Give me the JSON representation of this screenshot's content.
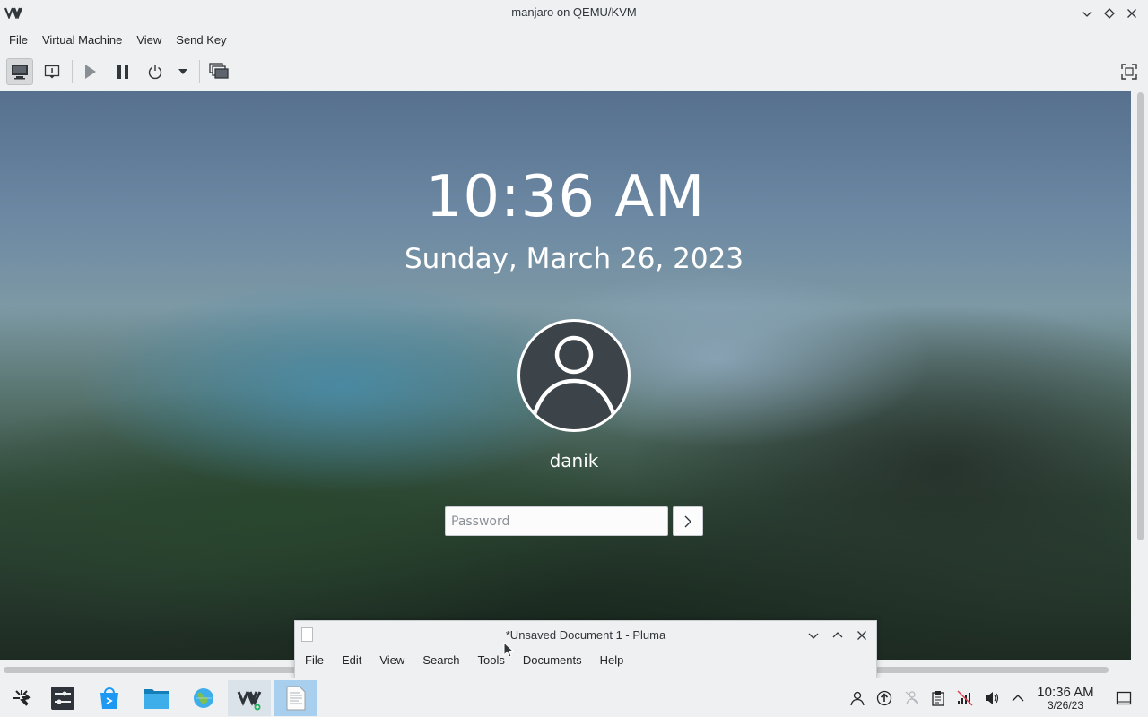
{
  "window": {
    "title": "manjaro on QEMU/KVM",
    "logo": "VM"
  },
  "menubar": {
    "items": [
      "File",
      "Virtual Machine",
      "View",
      "Send Key"
    ]
  },
  "toolbar": {
    "buttons": [
      "console-icon",
      "details-icon",
      "run-icon",
      "pause-icon",
      "shutdown-icon",
      "shutdown-menu-icon",
      "snapshots-icon",
      "fullscreen-icon"
    ]
  },
  "lockscreen": {
    "time": "10:36 AM",
    "date": "Sunday, March 26, 2023",
    "username": "danik",
    "password_placeholder": "Password",
    "password_value": ""
  },
  "pluma": {
    "title": "*Unsaved Document 1 - Pluma",
    "menu": [
      "File",
      "Edit",
      "View",
      "Search",
      "Tools",
      "Documents",
      "Help"
    ]
  },
  "taskbar": {
    "apps": [
      "application-launcher-icon",
      "system-settings-icon",
      "discover-icon",
      "file-manager-icon",
      "web-browser-icon",
      "virt-manager-icon",
      "pluma-icon"
    ],
    "clock_time": "10:36 AM",
    "clock_date": "3/26/23"
  },
  "colors": {
    "accent": "#3daee9",
    "focused_task": "#a8cfee",
    "chrome_bg": "#eff0f1"
  }
}
